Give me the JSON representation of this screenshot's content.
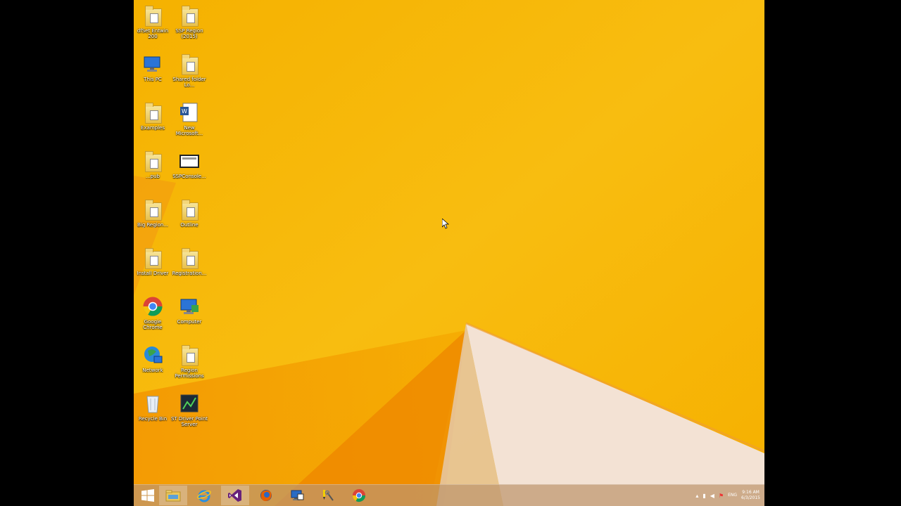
{
  "desktop": {
    "icons": [
      {
        "label": "dfSet Entwin 200",
        "icon": "folder-icon"
      },
      {
        "label": "SSP Region (2015)",
        "icon": "folder-icon"
      },
      {
        "label": "This PC",
        "icon": "this-pc-icon"
      },
      {
        "label": "Shared folder Lo...",
        "icon": "folder-icon"
      },
      {
        "label": "Examples",
        "icon": "folder-icon"
      },
      {
        "label": "New Microsoft...",
        "icon": "word-document-icon"
      },
      {
        "label": "...pub",
        "icon": "folder-icon"
      },
      {
        "label": "SSPConsole...",
        "icon": "screenshot-file-icon"
      },
      {
        "label": "Big Region...",
        "icon": "folder-icon"
      },
      {
        "label": "Outline",
        "icon": "folder-icon"
      },
      {
        "label": "Install Driver",
        "icon": "folder-icon"
      },
      {
        "label": "Registration...",
        "icon": "folder-icon"
      },
      {
        "label": "Google Chrome",
        "icon": "chrome-icon"
      },
      {
        "label": "Computer",
        "icon": "network-computer-icon"
      },
      {
        "label": "Network",
        "icon": "network-globe-icon"
      },
      {
        "label": "Region Permissions",
        "icon": "folder-icon"
      },
      {
        "label": "Recycle Bin",
        "icon": "recycle-bin-icon"
      },
      {
        "label": "ST Driver Point Server",
        "icon": "app-shortcut-icon"
      }
    ]
  },
  "taskbar": {
    "buttons": [
      {
        "name": "start-button",
        "icon": "windows-logo-icon"
      },
      {
        "name": "file-explorer-button",
        "icon": "folder-icon"
      },
      {
        "name": "internet-explorer-button",
        "icon": "ie-icon"
      },
      {
        "name": "visual-studio-button",
        "icon": "visual-studio-icon"
      },
      {
        "name": "firefox-button",
        "icon": "firefox-icon"
      },
      {
        "name": "remote-desktop-button",
        "icon": "remote-desktop-icon"
      },
      {
        "name": "tools-button",
        "icon": "tools-icon"
      },
      {
        "name": "chrome-button",
        "icon": "chrome-icon"
      }
    ],
    "tray": {
      "language": "ENG",
      "time": "9:16 AM",
      "date": "6/3/2015"
    }
  },
  "colors": {
    "wallpaper_orange": "#F7B500",
    "wallpaper_deep": "#F08A00",
    "wallpaper_light": "#F5E6D6",
    "taskbar": "#C09470"
  }
}
